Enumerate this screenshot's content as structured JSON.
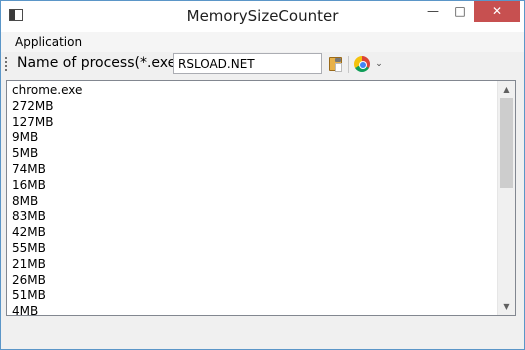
{
  "window": {
    "title": "MemorySizeCounter",
    "icon": "app-window-icon",
    "controls": {
      "minimize": "—",
      "maximize": "□",
      "close": "✕"
    }
  },
  "menu": {
    "items": [
      "Application"
    ]
  },
  "toolbar": {
    "label": "Name of process(*.exe)",
    "process_value": "RSLOAD.NET",
    "paste_icon": "clipboard-icon",
    "chrome_icon": "chrome-icon",
    "overflow_glyph": "⌄"
  },
  "list": {
    "items": [
      "chrome.exe",
      "272MB",
      "127MB",
      "9MB",
      "5MB",
      "74MB",
      "16MB",
      "8MB",
      "83MB",
      "42MB",
      "55MB",
      "21MB",
      "26MB",
      "51MB",
      "4MB"
    ]
  },
  "colors": {
    "close_button": "#c75050",
    "window_border": "#5b96c8"
  }
}
